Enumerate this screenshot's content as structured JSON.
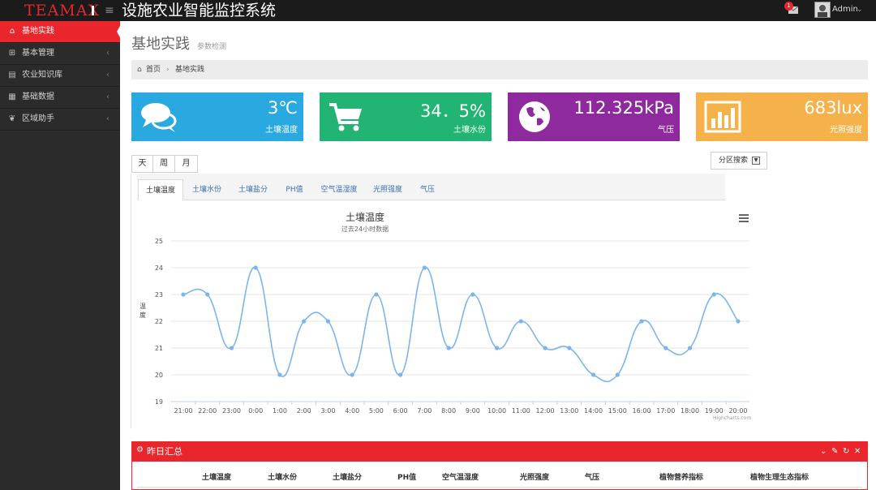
{
  "app": {
    "logo": "TEAMAX",
    "title": "设施农业智能监控系统",
    "user": "Admin",
    "notification_count": "1"
  },
  "sidebar": {
    "items": [
      {
        "label": "基地实践",
        "icon": "home-icon",
        "active": true
      },
      {
        "label": "基本管理",
        "icon": "sitemap-icon"
      },
      {
        "label": "农业知识库",
        "icon": "chart-icon"
      },
      {
        "label": "基础数据",
        "icon": "table-icon"
      },
      {
        "label": "区域助手",
        "icon": "leaf-icon"
      }
    ]
  },
  "page": {
    "title": "基地实践",
    "subtitle": "参数检测",
    "breadcrumb": {
      "home": "首页",
      "current": "基地实践"
    }
  },
  "tiles": [
    {
      "value": "3℃",
      "label": "土壤温度",
      "color": "#29a9e0",
      "icon": "comments-icon"
    },
    {
      "value": "34．5%",
      "label": "土壤水份",
      "color": "#21b473",
      "icon": "cart-icon"
    },
    {
      "value": "112.325kPa",
      "label": "气压",
      "color": "#8e2a9e",
      "icon": "globe-icon"
    },
    {
      "value": "683lux",
      "label": "光照强度",
      "color": "#f5b24a",
      "icon": "bar-chart-icon"
    }
  ],
  "period_buttons": [
    "天",
    "周",
    "月"
  ],
  "zone_search": "分区搜索",
  "metric_tabs": [
    "土壤温度",
    "土壤水份",
    "土壤盐分",
    "PH值",
    "空气温湿度",
    "光照强度",
    "气压"
  ],
  "chart_data": {
    "type": "line",
    "title": "土壤温度",
    "subtitle": "过去24小时数据",
    "ylabel": "温度",
    "credits": "Highcharts.com",
    "categories": [
      "21:00",
      "22:00",
      "23:00",
      "0:00",
      "1:00",
      "2:00",
      "3:00",
      "4:00",
      "5:00",
      "6:00",
      "7:00",
      "8:00",
      "9:00",
      "10:00",
      "11:00",
      "12:00",
      "13:00",
      "14:00",
      "15:00",
      "16:00",
      "17:00",
      "18:00",
      "19:00",
      "20:00"
    ],
    "series": [
      {
        "values": [
          23,
          23,
          21,
          24,
          20,
          22,
          22,
          20,
          23,
          20,
          24,
          21,
          23,
          21,
          22,
          21,
          21,
          20,
          20,
          22,
          21,
          21,
          23,
          22
        ]
      }
    ],
    "ylim": [
      19,
      25
    ],
    "yticks": [
      19,
      20,
      21,
      22,
      23,
      24,
      25
    ],
    "color": "#7cb5ec",
    "grid": true
  },
  "summary": {
    "title": "昨日汇总",
    "columns": [
      "土壤温度",
      "土壤水份",
      "土壤盐分",
      "PH值",
      "空气温湿度",
      "光照强度",
      "气压",
      "植物营养指标",
      "植物生理生态指标"
    ]
  }
}
